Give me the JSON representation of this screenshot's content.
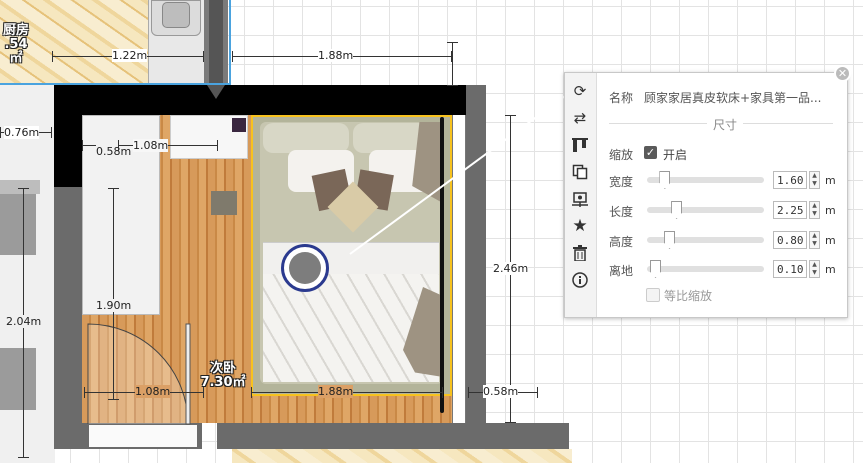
{
  "rooms": {
    "kitchen": {
      "name": "厨房",
      "area": ".54㎡"
    },
    "bedroom": {
      "name": "次卧",
      "area": "7.30㎡"
    }
  },
  "dimensions": {
    "kitchen_width": "1.22m",
    "top_width": "1.88m",
    "left_small": "0.76m",
    "closet_depth": "0.58m",
    "closet_width": "1.08m",
    "room_height": "1.90m",
    "left_height": "2.04m",
    "door_width": "1.08m",
    "bed_width": "1.88m",
    "right_height": "2.46m",
    "right_gap": "0.58m"
  },
  "panel": {
    "name_label": "名称",
    "name_value": "顾家家居真皮软床+家具第一品...",
    "section_title": "尺寸",
    "scale_label": "缩放",
    "scale_checkbox_label": "开启",
    "scale_checked": true,
    "width_label": "宽度",
    "width_value": "1.60",
    "length_label": "长度",
    "length_value": "2.25",
    "height_label": "高度",
    "height_value": "0.80",
    "elevation_label": "离地",
    "elevation_value": "0.10",
    "unit": "m",
    "proportional_label": "等比缩放",
    "proportional_checked": false,
    "slider_levels": {
      "width": 0.14,
      "length": 0.24,
      "height": 0.18,
      "elevation": 0.06
    }
  },
  "toolbar_icons": [
    "rotate-icon",
    "flip-icon",
    "align-icon",
    "copy-icon",
    "center-icon",
    "favorite-icon",
    "delete-icon",
    "info-icon"
  ],
  "colors": {
    "selection": "#f7c21e",
    "handle": "#2b3a8f",
    "wall_dark": "#000000",
    "wall_gray": "#6b6b6b",
    "link_line": "#ffffff"
  }
}
